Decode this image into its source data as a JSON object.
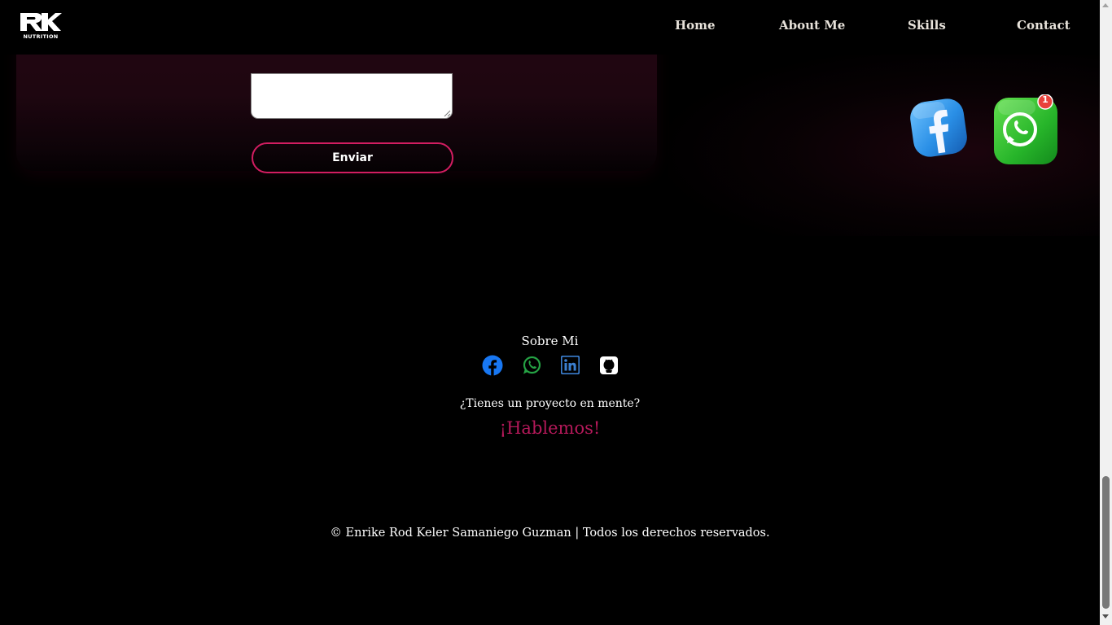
{
  "header": {
    "logo_text": "RK",
    "logo_subtext": "NUTRITION",
    "nav": [
      {
        "label": "Home"
      },
      {
        "label": "About Me"
      },
      {
        "label": "Skills"
      },
      {
        "label": "Contact"
      }
    ]
  },
  "contact_form": {
    "message_value": "",
    "submit_label": "Enviar"
  },
  "floating_apps": {
    "facebook_icon": "facebook-app-icon",
    "whatsapp_icon": "whatsapp-app-icon",
    "whatsapp_badge": "1"
  },
  "footer": {
    "about_title": "Sobre Mi",
    "socials": [
      {
        "icon": "facebook-icon",
        "color": "#1877f2"
      },
      {
        "icon": "whatsapp-icon",
        "color": "#25a244"
      },
      {
        "icon": "linkedin-icon",
        "color": "#3b7fd0"
      },
      {
        "icon": "github-icon",
        "color": "#ffffff"
      }
    ],
    "project_question": "¿Tienes un proyecto en mente?",
    "cta": "¡Hablemos!",
    "copyright": "© Enrike Rod Keler Samaniego Guzman | Todos los derechos reservados."
  },
  "colors": {
    "accent": "#d21d61",
    "cta": "#b5195a",
    "background": "#000000"
  }
}
